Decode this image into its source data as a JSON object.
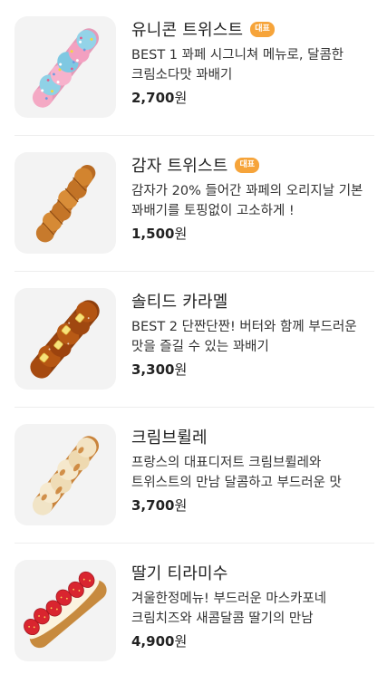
{
  "menu": {
    "items": [
      {
        "name": "유니콘 트위스트",
        "badge": "대표",
        "description": "BEST 1 꽈페 시그니쳐 메뉴로, 달콤한 크림소다맛 꽈배기",
        "price": "2,700",
        "currency": "원",
        "image_icon": "unicorn-twist-icon"
      },
      {
        "name": "감자 트위스트",
        "badge": "대표",
        "description": "감자가 20% 들어간 꽈페의 오리지날 기본 꽈배기를 토핑없이 고소하게 !",
        "price": "1,500",
        "currency": "원",
        "image_icon": "potato-twist-icon"
      },
      {
        "name": "솔티드 카라멜",
        "badge": "",
        "description": "BEST 2 단짠단짠! 버터와 함께 부드러운 맛을 즐길 수 있는 꽈배기",
        "price": "3,300",
        "currency": "원",
        "image_icon": "salted-caramel-twist-icon"
      },
      {
        "name": "크림브륄레",
        "badge": "",
        "description": "프랑스의 대표디저트 크림브륄레와 트위스트의 만남 달콤하고 부드러운 맛",
        "price": "3,700",
        "currency": "원",
        "image_icon": "creme-brulee-twist-icon"
      },
      {
        "name": "딸기 티라미수",
        "badge": "",
        "description": "겨울한정메뉴! 부드러운 마스카포네 크림치즈와 새콤달콤 딸기의 만남",
        "price": "4,900",
        "currency": "원",
        "image_icon": "strawberry-tiramisu-twist-icon"
      }
    ]
  },
  "colors": {
    "badge": "#f6a43a",
    "divider": "#eeeeee",
    "thumbnail_bg": "#f3f3f3"
  }
}
